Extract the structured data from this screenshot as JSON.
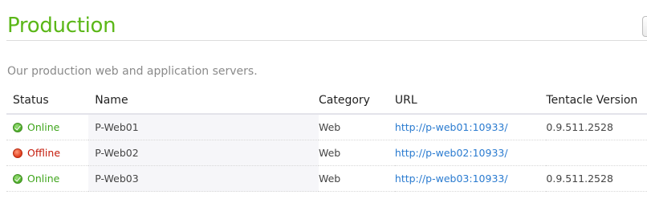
{
  "page": {
    "title": "Production",
    "subtitle": "Our production web and application servers."
  },
  "table": {
    "columns": {
      "status": "Status",
      "name": "Name",
      "category": "Category",
      "url": "URL",
      "tentacle_version": "Tentacle Version"
    },
    "rows": [
      {
        "status": "Online",
        "status_icon": "check-circle-icon",
        "status_color": "#3fa51c",
        "name": "P-Web01",
        "category": "Web",
        "url": "http://p-web01:10933/",
        "tentacle_version": "0.9.511.2528"
      },
      {
        "status": "Offline",
        "status_icon": "red-circle-icon",
        "status_color": "#c41b0b",
        "name": "P-Web02",
        "category": "Web",
        "url": "http://p-web02:10933/",
        "tentacle_version": ""
      },
      {
        "status": "Online",
        "status_icon": "check-circle-icon",
        "status_color": "#3fa51c",
        "name": "P-Web03",
        "category": "Web",
        "url": "http://p-web03:10933/",
        "tentacle_version": "0.9.511.2528"
      }
    ]
  },
  "colors": {
    "title": "#5bb718",
    "link": "#2a7bd0",
    "subtitle": "#8a8a8a"
  }
}
